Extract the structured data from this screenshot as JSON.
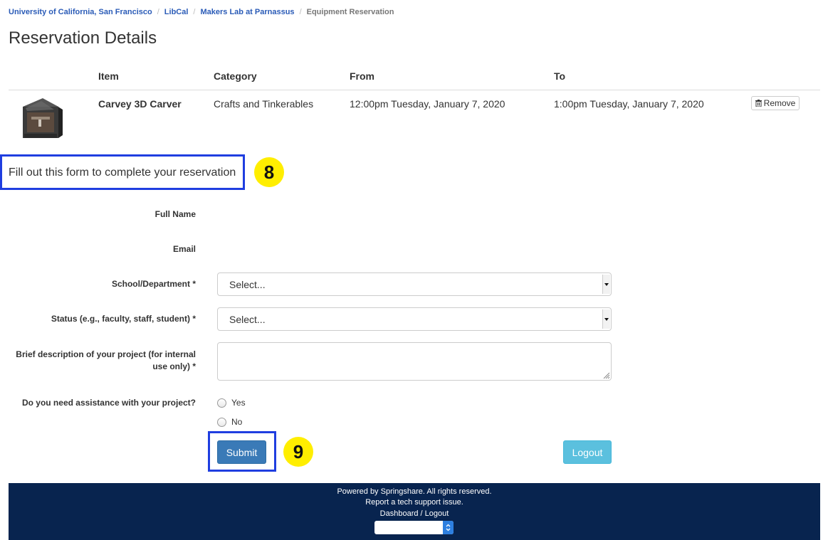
{
  "breadcrumb": {
    "items": [
      "University of California, San Francisco",
      "LibCal",
      "Makers Lab at Parnassus"
    ],
    "current": "Equipment Reservation",
    "separator": "/"
  },
  "page_title": "Reservation Details",
  "table": {
    "headers": {
      "item": "Item",
      "category": "Category",
      "from": "From",
      "to": "To"
    },
    "row": {
      "item": "Carvey 3D Carver",
      "category": "Crafts and Tinkerables",
      "from": "12:00pm Tuesday, January 7, 2020",
      "to": "1:00pm Tuesday, January 7, 2020",
      "remove_label": "Remove",
      "image_icon": "3d-carver-machine-icon"
    }
  },
  "form": {
    "intro": "Fill out this form to complete your reservation",
    "full_name_label": "Full Name",
    "email_label": "Email",
    "school_label": "School/Department *",
    "school_value": "Select...",
    "status_label": "Status (e.g., faculty, staff, student) *",
    "status_value": "Select...",
    "description_label_line1": "Brief description of your project (for internal",
    "description_label_line2": "use only) *",
    "assistance_label": "Do you need assistance with your project?",
    "assistance_options": [
      "Yes",
      "No"
    ],
    "submit_label": "Submit",
    "logout_label": "Logout"
  },
  "annotations": {
    "step_8": "8",
    "step_9": "9",
    "callout_color": "#1f3ee0",
    "badge_color": "#ffee00"
  },
  "footer": {
    "line1": "Powered by Springshare. All rights reserved.",
    "line2": "Report a tech support issue.",
    "line3": "Dashboard / Logout",
    "background": "#08244f"
  }
}
